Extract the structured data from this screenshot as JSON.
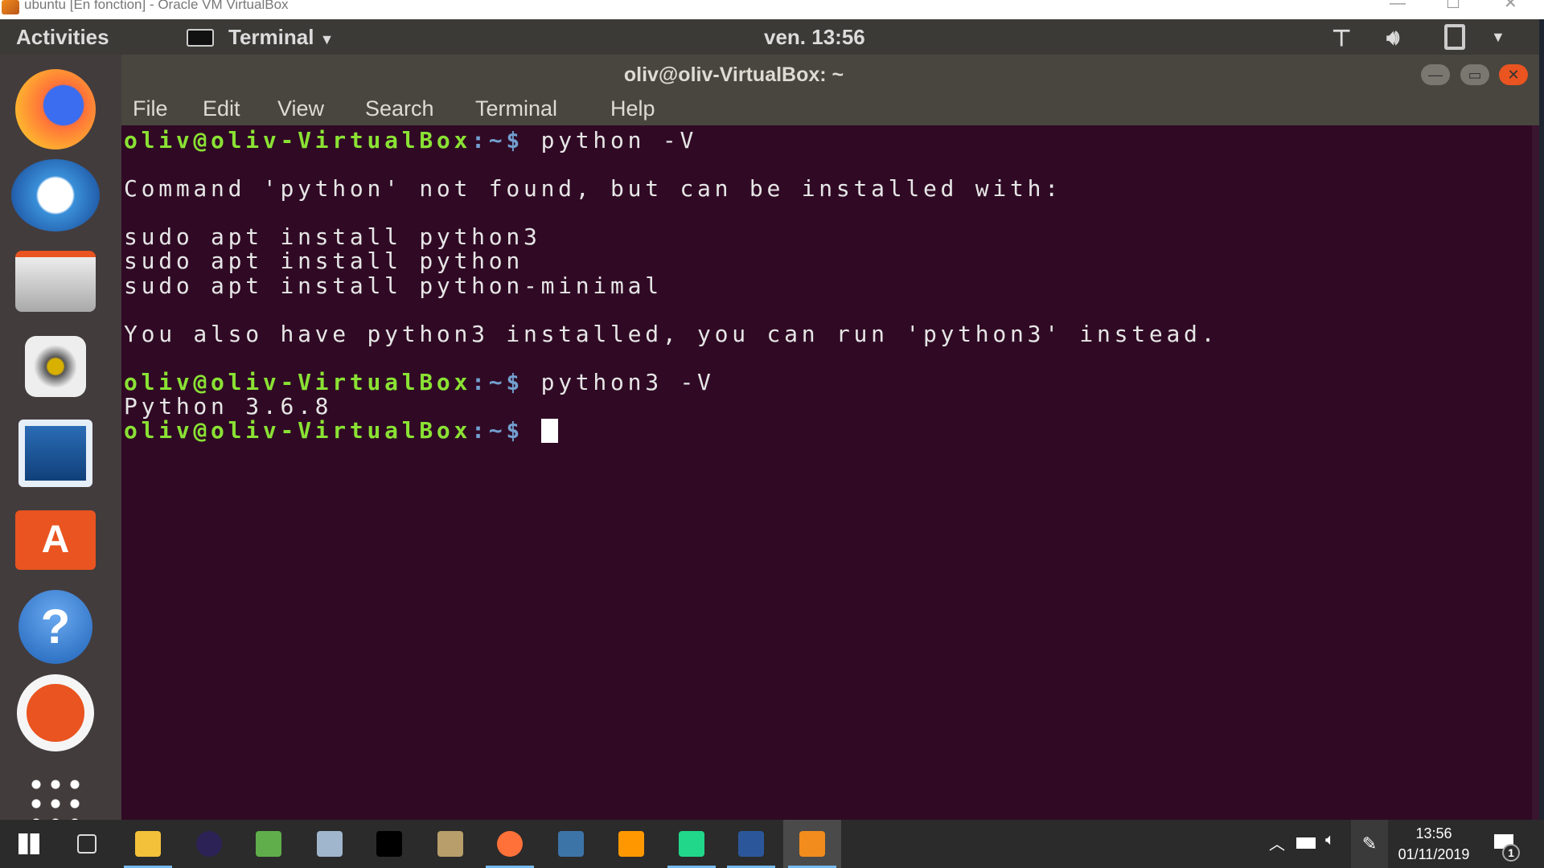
{
  "host": {
    "title": "ubuntu [En fonction] - Oracle VM VirtualBox",
    "minimize": "—",
    "maximize": "☐",
    "close": "✕"
  },
  "topbar": {
    "activities": "Activities",
    "app_menu": "Terminal",
    "clock": "ven. 13:56",
    "icons": [
      "network-icon",
      "volume-icon",
      "battery-icon",
      "system-menu-chevron-icon"
    ]
  },
  "dock": {
    "items": [
      "firefox",
      "thunderbird",
      "files",
      "rhythmbox",
      "libreoffice-writer",
      "ubuntu-software",
      "help",
      "ubuntu-amazon",
      "show-applications"
    ]
  },
  "window": {
    "title": "oliv@oliv-VirtualBox: ~",
    "menu": [
      "File",
      "Edit",
      "View",
      "Search",
      "Terminal",
      "Help"
    ]
  },
  "terminal": {
    "prompt_user": "oliv@oliv-VirtualBox",
    "prompt_path": ":~$",
    "lines": [
      {
        "type": "prompt",
        "cmd": " python -V"
      },
      {
        "type": "out",
        "text": ""
      },
      {
        "type": "out",
        "text": "Command 'python' not found, but can be installed with:"
      },
      {
        "type": "out",
        "text": ""
      },
      {
        "type": "out",
        "text": "sudo apt install python3"
      },
      {
        "type": "out",
        "text": "sudo apt install python"
      },
      {
        "type": "out",
        "text": "sudo apt install python-minimal"
      },
      {
        "type": "out",
        "text": ""
      },
      {
        "type": "out",
        "text": "You also have python3 installed, you can run 'python3' instead."
      },
      {
        "type": "out",
        "text": ""
      },
      {
        "type": "prompt",
        "cmd": " python3 -V"
      },
      {
        "type": "out",
        "text": "Python 3.6.8"
      },
      {
        "type": "prompt",
        "cmd": " ",
        "cursor": true
      }
    ]
  },
  "taskbar": {
    "items": [
      {
        "name": "start",
        "color": "#ffffff"
      },
      {
        "name": "task-view",
        "color": "#dddddd"
      },
      {
        "name": "file-explorer",
        "color": "#f3c13a",
        "active": true
      },
      {
        "name": "eclipse",
        "color": "#2c2255"
      },
      {
        "name": "git-extensions",
        "color": "#5fae4b"
      },
      {
        "name": "database-tool",
        "color": "#9fb6cc"
      },
      {
        "name": "command-prompt",
        "color": "#000000"
      },
      {
        "name": "installer",
        "color": "#b89e6b"
      },
      {
        "name": "firefox",
        "color": "#ff7139",
        "active": true
      },
      {
        "name": "python-idle",
        "color": "#3d74a8"
      },
      {
        "name": "sublime-text",
        "color": "#ff9800"
      },
      {
        "name": "pycharm",
        "color": "#21d789",
        "active": true
      },
      {
        "name": "word",
        "color": "#2b579a",
        "active": true
      },
      {
        "name": "virtualbox",
        "color": "#f28c1c",
        "active": true,
        "highlight": true
      }
    ],
    "tray": {
      "time": "13:56",
      "date": "01/11/2019",
      "notifications": "1"
    }
  },
  "colors": {
    "terminal_bg": "#300a24",
    "prompt_user": "#8ae234",
    "prompt_path": "#729fcf",
    "close_button": "#e95420"
  }
}
